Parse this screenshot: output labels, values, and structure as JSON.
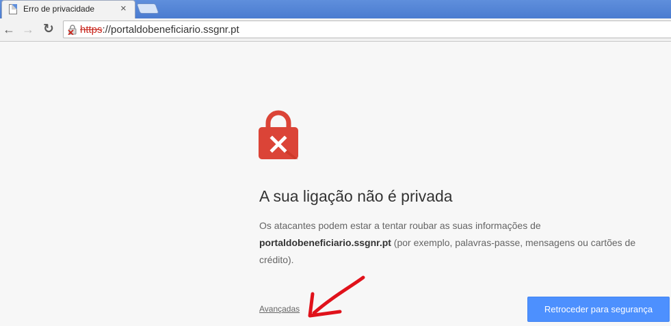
{
  "tab": {
    "title": "Erro de privacidade",
    "close_glyph": "×",
    "favicon": "page-icon"
  },
  "toolbar": {
    "back_glyph": "←",
    "forward_glyph": "→",
    "reload_glyph": "↻",
    "url_scheme": "https",
    "url_rest": "://portaldobeneficiario.ssgnr.pt",
    "security_icon": "broken-lock-icon"
  },
  "interstitial": {
    "icon": "lock-error-icon",
    "heading": "A sua ligação não é privada",
    "para_before": "Os atacantes podem estar a tentar roubar as suas informações de ",
    "para_domain": "portaldobeneficiario.ssgnr.pt",
    "para_after": " (por exemplo, palavras-passe, mensagens ou cartões de crédito).",
    "advanced_label": "Avançadas",
    "back_button_label": "Retroceder para segurança"
  },
  "colors": {
    "tabstrip": "#5f8fdc",
    "lock_red": "#db4437",
    "button_blue": "#4d90fe",
    "annotation_red": "#e0121b"
  },
  "annotation": {
    "icon": "red-arrow-icon"
  }
}
